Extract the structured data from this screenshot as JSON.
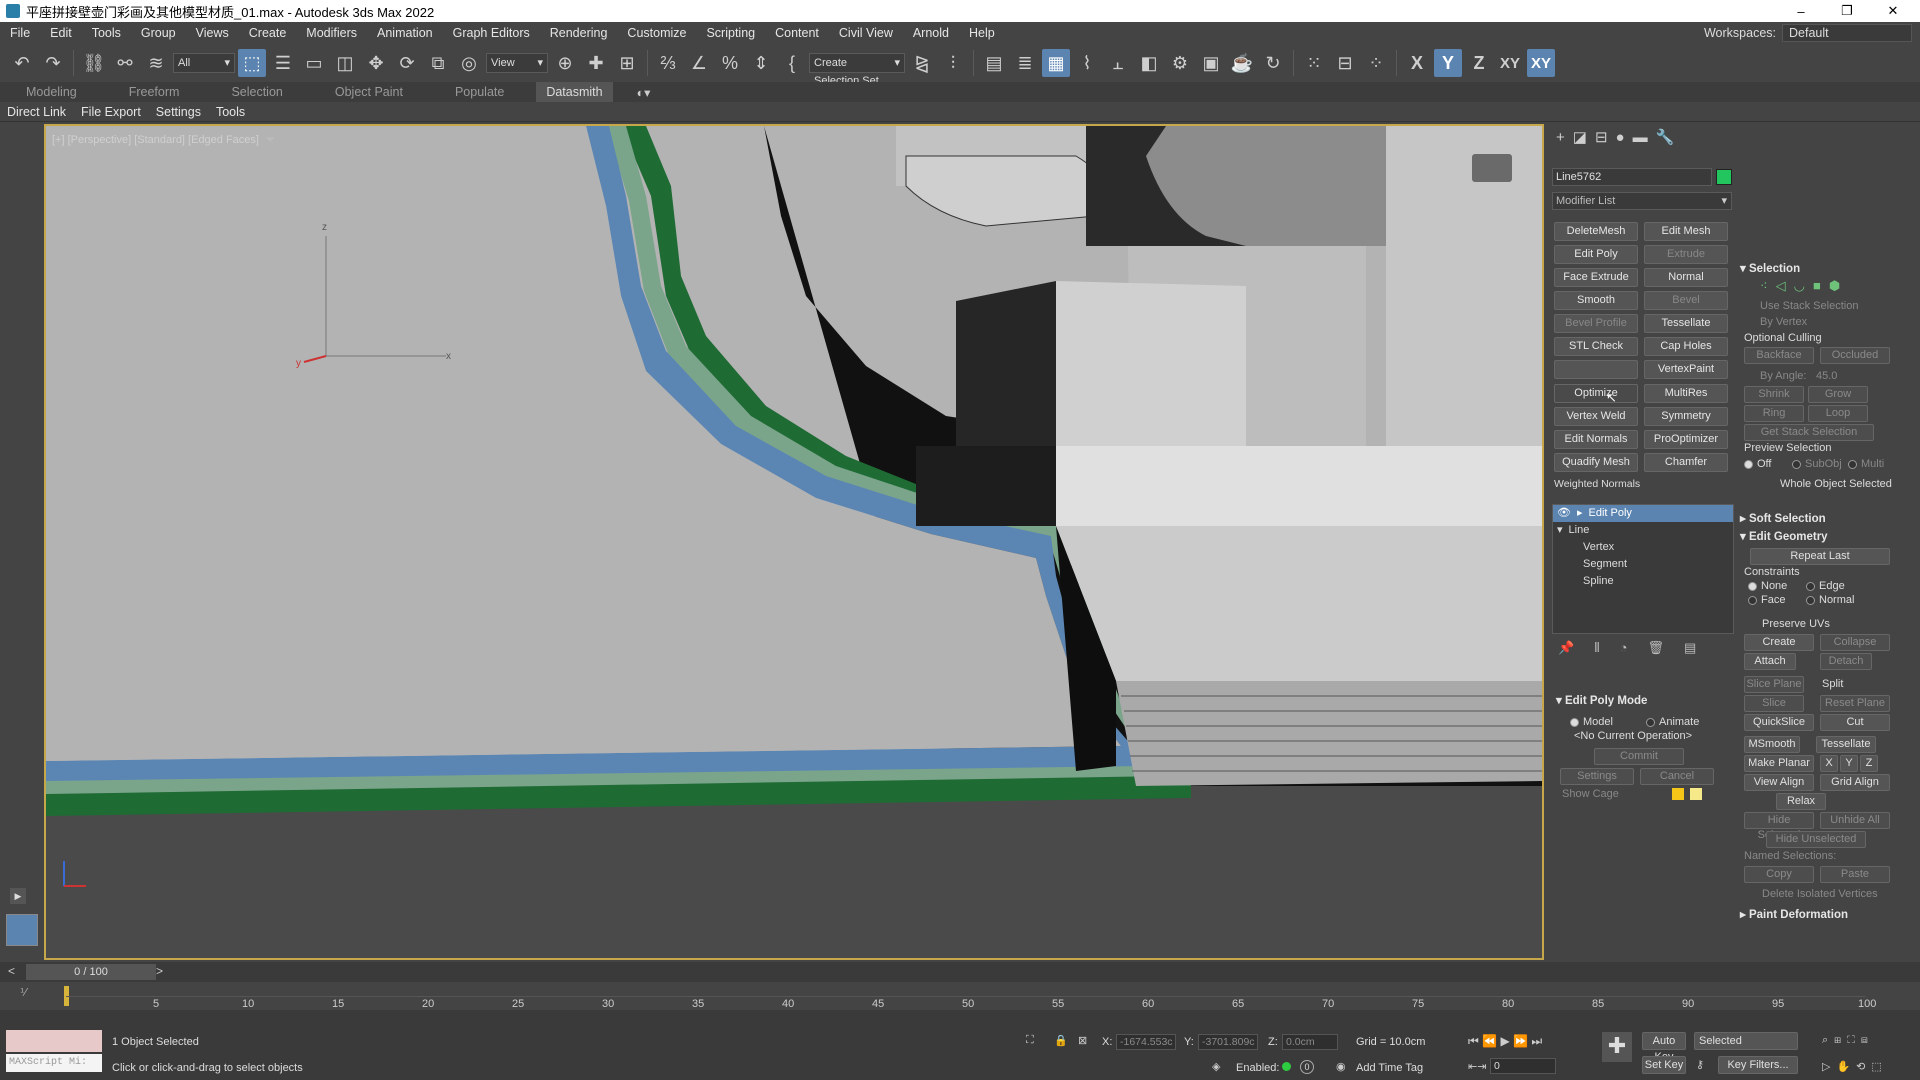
{
  "titlebar": {
    "title": "平座拼接壁壶门彩画及其他模型材质_01.max - Autodesk 3ds Max 2022",
    "minimize": "–",
    "restore": "❐",
    "close": "✕"
  },
  "menu": {
    "items": [
      "File",
      "Edit",
      "Tools",
      "Group",
      "Views",
      "Create",
      "Modifiers",
      "Animation",
      "Graph Editors",
      "Rendering",
      "Customize",
      "Scripting",
      "Content",
      "Civil View",
      "Arnold",
      "Help"
    ],
    "workspaces_label": "Workspaces:",
    "workspaces_value": "Default"
  },
  "toolbar": {
    "filter_value": "All",
    "view_value": "View",
    "create_selection_set": "Create Selection Set",
    "axis_x": "X",
    "axis_y": "Y",
    "axis_z": "Z",
    "axis_xy": "XY",
    "axis_xy2": "XY"
  },
  "ribbon": {
    "tabs": [
      "Modeling",
      "Freeform",
      "Selection",
      "Object Paint",
      "Populate",
      "Datasmith"
    ]
  },
  "subbar": {
    "items": [
      "Direct Link",
      "File Export",
      "Settings",
      "Tools"
    ]
  },
  "viewport": {
    "label": "[+] [Perspective] [Standard] [Edged Faces]",
    "axis_z": "z",
    "axis_x": "x",
    "axis_y": "y"
  },
  "cmd": {
    "object_name": "Line5762",
    "modifier_list": "Modifier List",
    "mod_buttons": [
      [
        "DeleteMesh",
        "Edit Mesh"
      ],
      [
        "Edit Poly",
        "Extrude"
      ],
      [
        "Face Extrude",
        "Normal"
      ],
      [
        "Smooth",
        "Bevel"
      ],
      [
        "Bevel Profile",
        "Tessellate"
      ],
      [
        "STL Check",
        "Cap Holes"
      ],
      [
        "",
        "VertexPaint"
      ],
      [
        "Optimize",
        "MultiRes"
      ],
      [
        "Vertex Weld",
        "Symmetry"
      ],
      [
        "Edit Normals",
        "ProOptimizer"
      ],
      [
        "Quadify Mesh",
        "Chamfer"
      ]
    ],
    "weighted_normals": "Weighted Normals",
    "stack": [
      "Edit Poly",
      "Line",
      "Vertex",
      "Segment",
      "Spline"
    ],
    "editpoly_mode": {
      "header": "Edit Poly Mode",
      "model": "Model",
      "animate": "Animate",
      "no_op": "<No Current Operation>",
      "commit": "Commit",
      "settings": "Settings",
      "cancel": "Cancel",
      "show_cage": "Show Cage"
    }
  },
  "selection_panel": {
    "header": "Selection",
    "use_stack": "Use Stack Selection",
    "by_vertex": "By Vertex",
    "optional_culling": "Optional Culling",
    "backface": "Backface",
    "occluded": "Occluded",
    "by_angle": "By Angle:",
    "by_angle_val": "45.0",
    "shrink": "Shrink",
    "grow": "Grow",
    "ring": "Ring",
    "loop": "Loop",
    "get_stack": "Get Stack Selection",
    "preview": "Preview Selection",
    "off": "Off",
    "subobj": "SubObj",
    "multi": "Multi",
    "whole": "Whole Object Selected",
    "soft_selection": "Soft Selection",
    "edit_geometry": "Edit Geometry",
    "repeat_last": "Repeat Last",
    "constraints": "Constraints",
    "none": "None",
    "edge": "Edge",
    "face": "Face",
    "normal": "Normal",
    "preserve_uvs": "Preserve UVs",
    "create": "Create",
    "collapse": "Collapse",
    "attach": "Attach",
    "detach": "Detach",
    "slice_plane": "Slice Plane",
    "split": "Split",
    "slice": "Slice",
    "reset_plane": "Reset Plane",
    "quickslice": "QuickSlice",
    "cut": "Cut",
    "msmooth": "MSmooth",
    "tessellate": "Tessellate",
    "make_planar": "Make Planar",
    "x": "X",
    "y": "Y",
    "z": "Z",
    "view_align": "View Align",
    "grid_align": "Grid Align",
    "relax": "Relax",
    "hide_selected": "Hide Selected",
    "unhide_all": "Unhide All",
    "hide_unselected": "Hide Unselected",
    "named_sel": "Named Selections:",
    "copy": "Copy",
    "paste": "Paste",
    "delete_isolated": "Delete Isolated Vertices",
    "paint_deformation": "Paint Deformation"
  },
  "timeline": {
    "frame": "0 / 100",
    "ticks": [
      "5",
      "10",
      "15",
      "20",
      "25",
      "30",
      "35",
      "40",
      "45",
      "50",
      "55",
      "60",
      "65",
      "70",
      "75",
      "80",
      "85",
      "90",
      "95",
      "100"
    ]
  },
  "status": {
    "maxscript": "MAXScript Mi:",
    "selected": "1 Object Selected",
    "hint": "Click or click-and-drag to select objects",
    "x_label": "X:",
    "x_val": "-1674.553c",
    "y_label": "Y:",
    "y_val": "-3701.809c",
    "z_label": "Z:",
    "z_val": "0.0cm",
    "grid": "Grid = 10.0cm",
    "enabled": "Enabled:",
    "add_time_tag": "Add Time Tag",
    "auto_key": "Auto Key",
    "selected_dd": "Selected",
    "set_key": "Set Key",
    "key_filters": "Key Filters...",
    "frame_val": "0"
  }
}
